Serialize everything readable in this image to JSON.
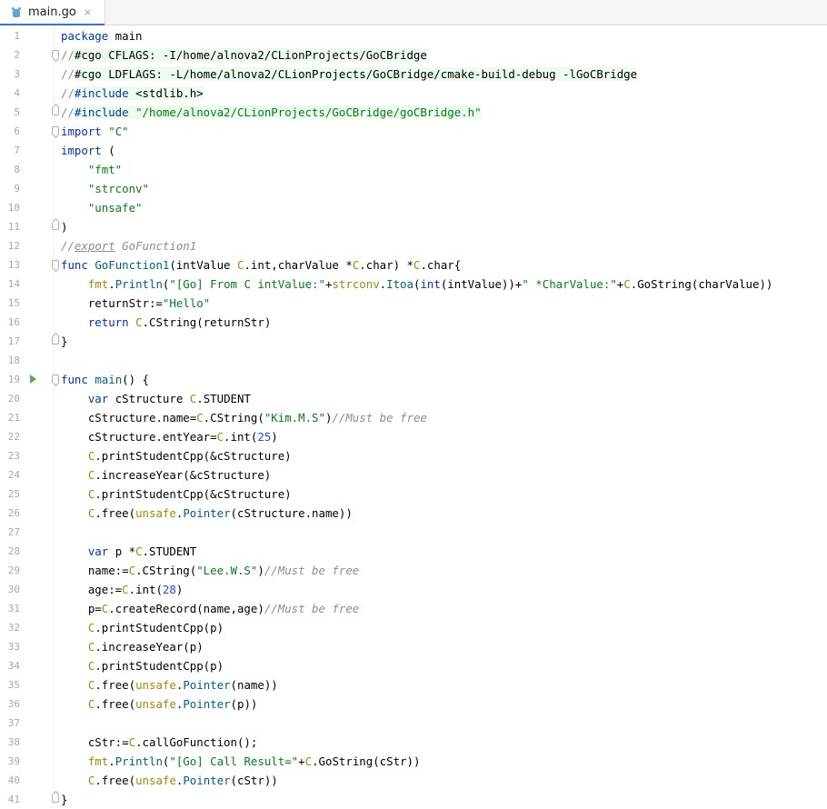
{
  "tab": {
    "filename": "main.go",
    "close_glyph": "×",
    "icon": "go-file-icon",
    "active_accent": "#3874d8"
  },
  "editor": {
    "run_line": 19,
    "fold_markers": {
      "2": "start",
      "5": "end",
      "6": "start",
      "11": "end",
      "13": "start",
      "17": "end",
      "19": "start",
      "41": "end"
    },
    "lines": [
      {
        "n": "1",
        "tokens": [
          {
            "c": "kw",
            "t": "package"
          },
          {
            "c": "txt",
            "t": " main"
          }
        ]
      },
      {
        "n": "2",
        "tokens": [
          {
            "c": "cmtn",
            "t": "//"
          },
          {
            "c": "txt hl",
            "t": "#cgo CFLAGS: -I/home/alnova2/CLionProjects/GoCBridge"
          }
        ]
      },
      {
        "n": "3",
        "tokens": [
          {
            "c": "cmtn",
            "t": "//"
          },
          {
            "c": "txt hl",
            "t": "#cgo LDFLAGS: -L/home/alnova2/CLionProjects/GoCBridge/cmake-build-debug -lGoCBridge"
          }
        ]
      },
      {
        "n": "4",
        "tokens": [
          {
            "c": "cmtn",
            "t": "//"
          },
          {
            "c": "kw hl",
            "t": "#include"
          },
          {
            "c": "txt hl",
            "t": " <stdlib.h>"
          }
        ]
      },
      {
        "n": "5",
        "tokens": [
          {
            "c": "cmtn",
            "t": "//"
          },
          {
            "c": "kw hl",
            "t": "#include"
          },
          {
            "c": "txt hl",
            "t": " "
          },
          {
            "c": "str hl",
            "t": "\"/home/alnova2/CLionProjects/GoCBridge/goCBridge.h\""
          }
        ]
      },
      {
        "n": "6",
        "tokens": [
          {
            "c": "kw",
            "t": "import"
          },
          {
            "c": "txt",
            "t": " "
          },
          {
            "c": "str",
            "t": "\"C\""
          }
        ]
      },
      {
        "n": "7",
        "tokens": [
          {
            "c": "kw",
            "t": "import"
          },
          {
            "c": "txt",
            "t": " ("
          }
        ]
      },
      {
        "n": "8",
        "tokens": [
          {
            "c": "txt",
            "t": "    "
          },
          {
            "c": "str",
            "t": "\"fmt\""
          }
        ]
      },
      {
        "n": "9",
        "tokens": [
          {
            "c": "txt",
            "t": "    "
          },
          {
            "c": "str",
            "t": "\"strconv\""
          }
        ]
      },
      {
        "n": "10",
        "tokens": [
          {
            "c": "txt",
            "t": "    "
          },
          {
            "c": "str",
            "t": "\"unsafe\""
          }
        ]
      },
      {
        "n": "11",
        "tokens": [
          {
            "c": "txt",
            "t": ")"
          }
        ]
      },
      {
        "n": "12",
        "tokens": [
          {
            "c": "cmt",
            "t": "//"
          },
          {
            "c": "cmt und",
            "t": "export"
          },
          {
            "c": "cmt",
            "t": " GoFunction1"
          }
        ]
      },
      {
        "n": "13",
        "tokens": [
          {
            "c": "kw",
            "t": "func"
          },
          {
            "c": "txt",
            "t": " "
          },
          {
            "c": "fn",
            "t": "GoFunction1"
          },
          {
            "c": "txt",
            "t": "(intValue "
          },
          {
            "c": "pkg",
            "t": "C"
          },
          {
            "c": "txt",
            "t": ".int,charValue *"
          },
          {
            "c": "pkg",
            "t": "C"
          },
          {
            "c": "txt",
            "t": ".char) *"
          },
          {
            "c": "pkg",
            "t": "C"
          },
          {
            "c": "txt",
            "t": ".char{"
          }
        ]
      },
      {
        "n": "14",
        "tokens": [
          {
            "c": "txt",
            "t": "    "
          },
          {
            "c": "pkg",
            "t": "fmt"
          },
          {
            "c": "txt",
            "t": "."
          },
          {
            "c": "fn",
            "t": "Println"
          },
          {
            "c": "txt",
            "t": "("
          },
          {
            "c": "str",
            "t": "\"[Go] From C intValue:\""
          },
          {
            "c": "txt",
            "t": "+"
          },
          {
            "c": "pkg",
            "t": "strconv"
          },
          {
            "c": "txt",
            "t": "."
          },
          {
            "c": "fn",
            "t": "Itoa"
          },
          {
            "c": "txt",
            "t": "("
          },
          {
            "c": "kw",
            "t": "int"
          },
          {
            "c": "txt",
            "t": "(intValue))+"
          },
          {
            "c": "str",
            "t": "\" *CharValue:\""
          },
          {
            "c": "txt",
            "t": "+"
          },
          {
            "c": "pkg",
            "t": "C"
          },
          {
            "c": "txt",
            "t": ".GoString(charValue))"
          }
        ]
      },
      {
        "n": "15",
        "tokens": [
          {
            "c": "txt",
            "t": "    returnStr:="
          },
          {
            "c": "str",
            "t": "\"Hello\""
          }
        ]
      },
      {
        "n": "16",
        "tokens": [
          {
            "c": "txt",
            "t": "    "
          },
          {
            "c": "kw",
            "t": "return"
          },
          {
            "c": "txt",
            "t": " "
          },
          {
            "c": "pkg",
            "t": "C"
          },
          {
            "c": "txt",
            "t": ".CString(returnStr)"
          }
        ]
      },
      {
        "n": "17",
        "tokens": [
          {
            "c": "txt",
            "t": "}"
          }
        ]
      },
      {
        "n": "18",
        "tokens": []
      },
      {
        "n": "19",
        "tokens": [
          {
            "c": "kw",
            "t": "func"
          },
          {
            "c": "txt",
            "t": " "
          },
          {
            "c": "fn",
            "t": "main"
          },
          {
            "c": "txt",
            "t": "() {"
          }
        ]
      },
      {
        "n": "20",
        "tokens": [
          {
            "c": "txt",
            "t": "    "
          },
          {
            "c": "kw",
            "t": "var"
          },
          {
            "c": "txt",
            "t": " cStructure "
          },
          {
            "c": "pkg",
            "t": "C"
          },
          {
            "c": "txt",
            "t": ".STUDENT"
          }
        ]
      },
      {
        "n": "21",
        "tokens": [
          {
            "c": "txt",
            "t": "    cStructure.name="
          },
          {
            "c": "pkg",
            "t": "C"
          },
          {
            "c": "txt",
            "t": ".CString("
          },
          {
            "c": "str",
            "t": "\"Kim.M.S\""
          },
          {
            "c": "txt",
            "t": ")"
          },
          {
            "c": "cmt",
            "t": "//Must be free"
          }
        ]
      },
      {
        "n": "22",
        "tokens": [
          {
            "c": "txt",
            "t": "    cStructure.entYear="
          },
          {
            "c": "pkg",
            "t": "C"
          },
          {
            "c": "txt",
            "t": ".int("
          },
          {
            "c": "num",
            "t": "25"
          },
          {
            "c": "txt",
            "t": ")"
          }
        ]
      },
      {
        "n": "23",
        "tokens": [
          {
            "c": "txt",
            "t": "    "
          },
          {
            "c": "pkg",
            "t": "C"
          },
          {
            "c": "txt",
            "t": ".printStudentCpp(&cStructure)"
          }
        ]
      },
      {
        "n": "24",
        "tokens": [
          {
            "c": "txt",
            "t": "    "
          },
          {
            "c": "pkg",
            "t": "C"
          },
          {
            "c": "txt",
            "t": ".increaseYear(&cStructure)"
          }
        ]
      },
      {
        "n": "25",
        "tokens": [
          {
            "c": "txt",
            "t": "    "
          },
          {
            "c": "pkg",
            "t": "C"
          },
          {
            "c": "txt",
            "t": ".printStudentCpp(&cStructure)"
          }
        ]
      },
      {
        "n": "26",
        "tokens": [
          {
            "c": "txt",
            "t": "    "
          },
          {
            "c": "pkg",
            "t": "C"
          },
          {
            "c": "txt",
            "t": ".free("
          },
          {
            "c": "pkg",
            "t": "unsafe"
          },
          {
            "c": "txt",
            "t": "."
          },
          {
            "c": "fn",
            "t": "Pointer"
          },
          {
            "c": "txt",
            "t": "(cStructure.name))"
          }
        ]
      },
      {
        "n": "27",
        "tokens": []
      },
      {
        "n": "28",
        "tokens": [
          {
            "c": "txt",
            "t": "    "
          },
          {
            "c": "kw",
            "t": "var"
          },
          {
            "c": "txt",
            "t": " p *"
          },
          {
            "c": "pkg",
            "t": "C"
          },
          {
            "c": "txt",
            "t": ".STUDENT"
          }
        ]
      },
      {
        "n": "29",
        "tokens": [
          {
            "c": "txt",
            "t": "    name:="
          },
          {
            "c": "pkg",
            "t": "C"
          },
          {
            "c": "txt",
            "t": ".CString("
          },
          {
            "c": "str",
            "t": "\"Lee.W.S\""
          },
          {
            "c": "txt",
            "t": ")"
          },
          {
            "c": "cmt",
            "t": "//Must be free"
          }
        ]
      },
      {
        "n": "30",
        "tokens": [
          {
            "c": "txt",
            "t": "    age:="
          },
          {
            "c": "pkg",
            "t": "C"
          },
          {
            "c": "txt",
            "t": ".int("
          },
          {
            "c": "num",
            "t": "28"
          },
          {
            "c": "txt",
            "t": ")"
          }
        ]
      },
      {
        "n": "31",
        "tokens": [
          {
            "c": "txt",
            "t": "    p="
          },
          {
            "c": "pkg",
            "t": "C"
          },
          {
            "c": "txt",
            "t": ".createRecord(name,age)"
          },
          {
            "c": "cmt",
            "t": "//Must be free"
          }
        ]
      },
      {
        "n": "32",
        "tokens": [
          {
            "c": "txt",
            "t": "    "
          },
          {
            "c": "pkg",
            "t": "C"
          },
          {
            "c": "txt",
            "t": ".printStudentCpp(p)"
          }
        ]
      },
      {
        "n": "33",
        "tokens": [
          {
            "c": "txt",
            "t": "    "
          },
          {
            "c": "pkg",
            "t": "C"
          },
          {
            "c": "txt",
            "t": ".increaseYear(p)"
          }
        ]
      },
      {
        "n": "34",
        "tokens": [
          {
            "c": "txt",
            "t": "    "
          },
          {
            "c": "pkg",
            "t": "C"
          },
          {
            "c": "txt",
            "t": ".printStudentCpp(p)"
          }
        ]
      },
      {
        "n": "35",
        "tokens": [
          {
            "c": "txt",
            "t": "    "
          },
          {
            "c": "pkg",
            "t": "C"
          },
          {
            "c": "txt",
            "t": ".free("
          },
          {
            "c": "pkg",
            "t": "unsafe"
          },
          {
            "c": "txt",
            "t": "."
          },
          {
            "c": "fn",
            "t": "Pointer"
          },
          {
            "c": "txt",
            "t": "(name))"
          }
        ]
      },
      {
        "n": "36",
        "tokens": [
          {
            "c": "txt",
            "t": "    "
          },
          {
            "c": "pkg",
            "t": "C"
          },
          {
            "c": "txt",
            "t": ".free("
          },
          {
            "c": "pkg",
            "t": "unsafe"
          },
          {
            "c": "txt",
            "t": "."
          },
          {
            "c": "fn",
            "t": "Pointer"
          },
          {
            "c": "txt",
            "t": "(p))"
          }
        ]
      },
      {
        "n": "37",
        "tokens": []
      },
      {
        "n": "38",
        "tokens": [
          {
            "c": "txt",
            "t": "    cStr:="
          },
          {
            "c": "pkg",
            "t": "C"
          },
          {
            "c": "txt",
            "t": ".callGoFunction();"
          }
        ]
      },
      {
        "n": "39",
        "tokens": [
          {
            "c": "txt",
            "t": "    "
          },
          {
            "c": "pkg",
            "t": "fmt"
          },
          {
            "c": "txt",
            "t": "."
          },
          {
            "c": "fn",
            "t": "Println"
          },
          {
            "c": "txt",
            "t": "("
          },
          {
            "c": "str",
            "t": "\"[Go] Call Result=\""
          },
          {
            "c": "txt",
            "t": "+"
          },
          {
            "c": "pkg",
            "t": "C"
          },
          {
            "c": "txt",
            "t": ".GoString(cStr))"
          }
        ]
      },
      {
        "n": "40",
        "tokens": [
          {
            "c": "txt",
            "t": "    "
          },
          {
            "c": "pkg",
            "t": "C"
          },
          {
            "c": "txt",
            "t": ".free("
          },
          {
            "c": "pkg",
            "t": "unsafe"
          },
          {
            "c": "txt",
            "t": "."
          },
          {
            "c": "fn",
            "t": "Pointer"
          },
          {
            "c": "txt",
            "t": "(cStr))"
          }
        ]
      },
      {
        "n": "41",
        "tokens": [
          {
            "c": "txt",
            "t": "}"
          }
        ]
      }
    ]
  }
}
